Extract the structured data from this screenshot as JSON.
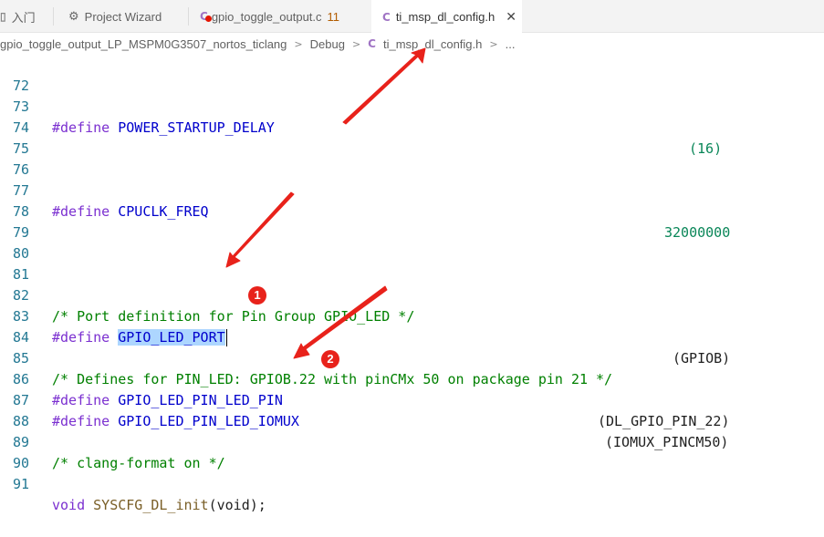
{
  "tabs": [
    {
      "label": "入门",
      "icon": "none"
    },
    {
      "label": "Project Wizard",
      "icon": "wizard-icon"
    },
    {
      "label": "gpio_toggle_output.c",
      "icon": "c-file-error-icon",
      "count": "11"
    },
    {
      "label": "ti_msp_dl_config.h",
      "icon": "c-file-icon",
      "active": true
    }
  ],
  "close_glyph": "✕",
  "breadcrumb": {
    "project": "gpio_toggle_output_LP_MSPM0G3507_nortos_ticlang",
    "folder": "Debug",
    "file": "ti_msp_dl_config.h",
    "more": "..."
  },
  "code_lines": [
    {
      "num": "72"
    },
    {
      "num": "73",
      "kw": "#define",
      "name": "POWER_STARTUP_DELAY",
      "value": "(16)"
    },
    {
      "num": "74"
    },
    {
      "num": "75"
    },
    {
      "num": "76"
    },
    {
      "num": "77",
      "kw": "#define",
      "name": "CPUCLK_FREQ",
      "value": "32000000"
    },
    {
      "num": "78"
    },
    {
      "num": "79"
    },
    {
      "num": "80"
    },
    {
      "num": "81"
    },
    {
      "num": "82",
      "comment": "/* Port definition for Pin Group GPIO_LED */"
    },
    {
      "num": "83",
      "kw": "#define",
      "name": "GPIO_LED_PORT",
      "value": "(GPIOB)"
    },
    {
      "num": "84"
    },
    {
      "num": "85",
      "comment": "/* Defines for PIN_LED: GPIOB.22 with pinCMx 50 on package pin 21 */"
    },
    {
      "num": "86",
      "kw": "#define",
      "name": "GPIO_LED_PIN_LED_PIN",
      "value": "(DL_GPIO_PIN_22)"
    },
    {
      "num": "87",
      "kw": "#define",
      "name": "GPIO_LED_PIN_LED_IOMUX",
      "value": "(IOMUX_PINCM50)"
    },
    {
      "num": "88"
    },
    {
      "num": "89",
      "comment": "/* clang-format on */"
    },
    {
      "num": "90"
    },
    {
      "num": "91",
      "type": "void",
      "func": "SYSCFG_DL_init",
      "args": "(void);"
    }
  ],
  "badges": [
    "1",
    "2"
  ],
  "colors": {
    "badge": "#e8221b",
    "arrow": "#e8221b",
    "selection": "#add6ff"
  }
}
